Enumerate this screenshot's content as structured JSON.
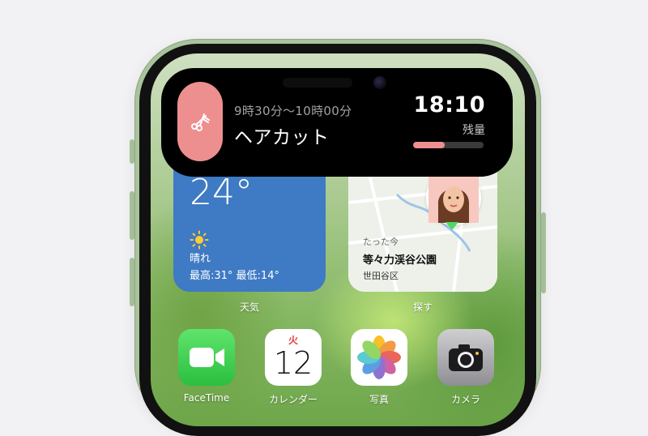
{
  "live_activity": {
    "time_range": "9時30分〜10時00分",
    "title": "ヘアカット",
    "end_time": "18:10",
    "remaining_label": "残量",
    "progress": 0.45,
    "accent_color": "#ee8f8f",
    "icon": "scissors-comb-icon"
  },
  "widgets": {
    "weather": {
      "temperature": "24°",
      "condition": "晴れ",
      "high_low": "最高:31° 最低:14°",
      "label": "天気",
      "icon": "sun-icon"
    },
    "find_my": {
      "time_ago": "たった今",
      "place": "等々力渓谷公園",
      "area": "世田谷区",
      "label": "探す"
    }
  },
  "dock_apps": [
    {
      "label": "FaceTime",
      "icon": "facetime-icon"
    },
    {
      "label": "カレンダー",
      "icon": "calendar-icon",
      "day_of_week": "火",
      "date": "12"
    },
    {
      "label": "写真",
      "icon": "photos-icon"
    },
    {
      "label": "カメラ",
      "icon": "camera-icon"
    }
  ]
}
